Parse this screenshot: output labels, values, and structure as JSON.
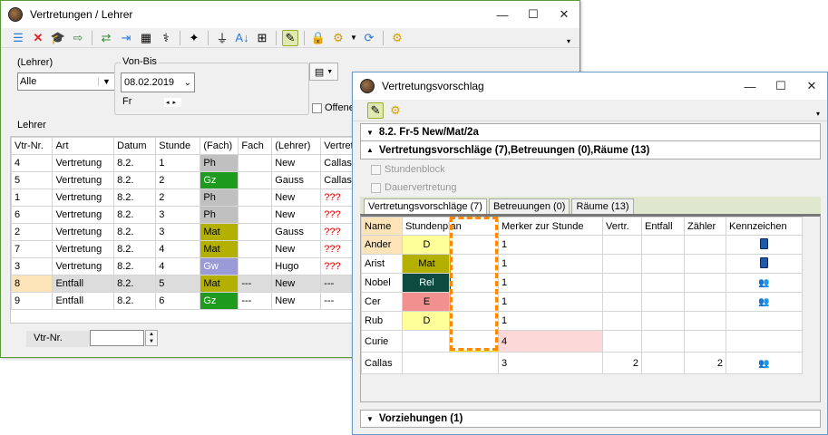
{
  "win1": {
    "title": "Vertretungen / Lehrer",
    "lehrer_label": "(Lehrer)",
    "lehrer_value": "Alle",
    "vonbis_label": "Von-Bis",
    "date_value": "08.02.2019",
    "day_label": "Fr",
    "offene_label": "Offene",
    "section_label": "Lehrer",
    "columns": [
      "Vtr-Nr.",
      "Art",
      "Datum",
      "Stunde",
      "(Fach)",
      "Fach",
      "(Lehrer)",
      "Vertreter"
    ],
    "rows": [
      {
        "nr": "4",
        "art": "Vertretung",
        "datum": "8.2.",
        "stunde": "1",
        "fach_orig": "Ph",
        "fach_color": "#c0c0c0",
        "fach_text": "#000",
        "fach": "",
        "lehrer": "New",
        "vertreter": "Callas",
        "vred": false,
        "bg": "#fff"
      },
      {
        "nr": "5",
        "art": "Vertretung",
        "datum": "8.2.",
        "stunde": "2",
        "fach_orig": "Gz",
        "fach_color": "#1e9a1e",
        "fach_text": "#fff",
        "fach": "",
        "lehrer": "Gauss",
        "vertreter": "Callas",
        "vred": false,
        "bg": "#fff"
      },
      {
        "nr": "1",
        "art": "Vertretung",
        "datum": "8.2.",
        "stunde": "2",
        "fach_orig": "Ph",
        "fach_color": "#c0c0c0",
        "fach_text": "#000",
        "fach": "",
        "lehrer": "New",
        "vertreter": "???",
        "vred": true,
        "bg": "#fff"
      },
      {
        "nr": "6",
        "art": "Vertretung",
        "datum": "8.2.",
        "stunde": "3",
        "fach_orig": "Ph",
        "fach_color": "#c0c0c0",
        "fach_text": "#000",
        "fach": "",
        "lehrer": "New",
        "vertreter": "???",
        "vred": true,
        "bg": "#fff"
      },
      {
        "nr": "2",
        "art": "Vertretung",
        "datum": "8.2.",
        "stunde": "3",
        "fach_orig": "Mat",
        "fach_color": "#b3b000",
        "fach_text": "#000",
        "fach": "",
        "lehrer": "Gauss",
        "vertreter": "???",
        "vred": true,
        "bg": "#fff"
      },
      {
        "nr": "7",
        "art": "Vertretung",
        "datum": "8.2.",
        "stunde": "4",
        "fach_orig": "Mat",
        "fach_color": "#b3b000",
        "fach_text": "#000",
        "fach": "",
        "lehrer": "New",
        "vertreter": "???",
        "vred": true,
        "bg": "#fff"
      },
      {
        "nr": "3",
        "art": "Vertretung",
        "datum": "8.2.",
        "stunde": "4",
        "fach_orig": "Gw",
        "fach_color": "#9a9ad8",
        "fach_text": "#fff",
        "fach": "",
        "lehrer": "Hugo",
        "vertreter": "???",
        "vred": true,
        "bg": "#fff"
      },
      {
        "nr": "8",
        "art": "Entfall",
        "datum": "8.2.",
        "stunde": "5",
        "fach_orig": "Mat",
        "fach_color": "#b3b000",
        "fach_text": "#000",
        "fach": "---",
        "lehrer": "New",
        "vertreter": "---",
        "vred": false,
        "bg": "#dcdcdc"
      },
      {
        "nr": "9",
        "art": "Entfall",
        "datum": "8.2.",
        "stunde": "6",
        "fach_orig": "Gz",
        "fach_color": "#1e9a1e",
        "fach_text": "#fff",
        "fach": "---",
        "lehrer": "New",
        "vertreter": "---",
        "vred": false,
        "bg": "#fff"
      }
    ],
    "vtr_label": "Vtr-Nr."
  },
  "win2": {
    "title": "Vertretungsvorschlag",
    "header": "8.2. Fr-5 New/Mat/2a",
    "section1": "Vertretungsvorschläge (7),Betreuungen (0),Räume (13)",
    "chk1": "Stundenblock",
    "chk2": "Dauervertretung",
    "tabs": [
      "Vertretungsvorschläge (7)",
      "Betreuungen (0)",
      "Räume (13)"
    ],
    "columns": [
      "Name",
      "Stundenplan",
      "Merker zur Stunde",
      "Vertr.",
      "Entfall",
      "Zähler",
      "Kennzeichen"
    ],
    "rows": [
      {
        "name": "Ander",
        "subj": "D",
        "scolor": "#ffff99",
        "stext": "#000",
        "merker": "1",
        "vertr": "",
        "entfall": "",
        "zaehler": "",
        "icon": "book-icon",
        "name_bg": "#fde4b8",
        "mbg": "#fff"
      },
      {
        "name": "Arist",
        "subj": "Mat",
        "scolor": "#b3b000",
        "stext": "#000",
        "merker": "1",
        "vertr": "",
        "entfall": "",
        "zaehler": "",
        "icon": "book-icon",
        "name_bg": "#fff",
        "mbg": "#fff"
      },
      {
        "name": "Nobel",
        "subj": "Rel",
        "scolor": "#0d4a40",
        "stext": "#fff",
        "merker": "1",
        "vertr": "",
        "entfall": "",
        "zaehler": "",
        "icon": "people-icon",
        "name_bg": "#fff",
        "mbg": "#fff"
      },
      {
        "name": "Cer",
        "subj": "E",
        "scolor": "#f29090",
        "stext": "#000",
        "merker": "1",
        "vertr": "",
        "entfall": "",
        "zaehler": "",
        "icon": "people-icon",
        "name_bg": "#fff",
        "mbg": "#fff"
      },
      {
        "name": "Rub",
        "subj": "D",
        "scolor": "#ffff99",
        "stext": "#000",
        "merker": "1",
        "vertr": "",
        "entfall": "",
        "zaehler": "",
        "icon": "",
        "name_bg": "#fff",
        "mbg": "#fff"
      },
      {
        "name": "Curie",
        "subj": "",
        "scolor": "#fff",
        "stext": "#000",
        "merker": "4",
        "vertr": "",
        "entfall": "",
        "zaehler": "",
        "icon": "",
        "name_bg": "#fff",
        "mbg": "#fcd8d8"
      },
      {
        "name": "Callas",
        "subj": "",
        "scolor": "#fff",
        "stext": "#000",
        "merker": "3",
        "vertr": "2",
        "entfall": "",
        "zaehler": "2",
        "icon": "people-icon",
        "name_bg": "#fff",
        "mbg": "#fff"
      }
    ],
    "footer": "Vorziehungen (1)"
  }
}
